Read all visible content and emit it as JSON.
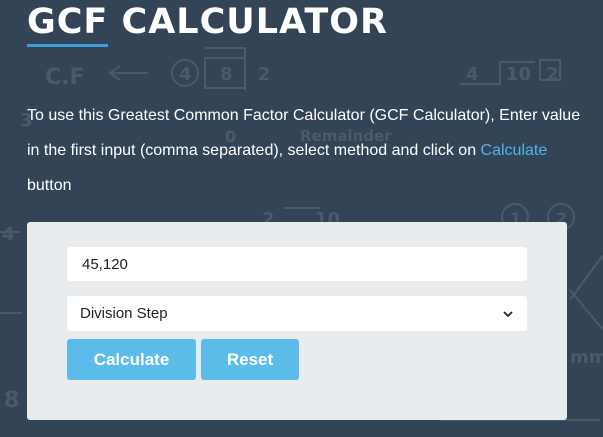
{
  "page": {
    "title": "GCF CALCULATOR",
    "intro": {
      "before_link": "To use this Greatest Common Factor Calculator (GCF Calculator), Enter value in the first input (comma separated), select method and click on ",
      "link_text": "Calculate",
      "after_link": " button"
    }
  },
  "form": {
    "numbers_value": "45,120",
    "method_selected": "Division Step",
    "calculate_label": "Calculate",
    "reset_label": "Reset"
  },
  "background_decoration": {
    "labels": [
      "C.F",
      "4",
      "8",
      "2",
      "4",
      "10",
      "2",
      "3",
      "0",
      "Remainder",
      "2",
      "10",
      "1",
      "2",
      "4",
      "8",
      "mm"
    ]
  },
  "colors": {
    "background": "#344457",
    "accent": "#3aa0db",
    "link": "#4fb5ea",
    "button": "#5bbcea",
    "panel": "#e9ecef"
  },
  "icons": {
    "select_arrow": "chevron-down-icon"
  }
}
